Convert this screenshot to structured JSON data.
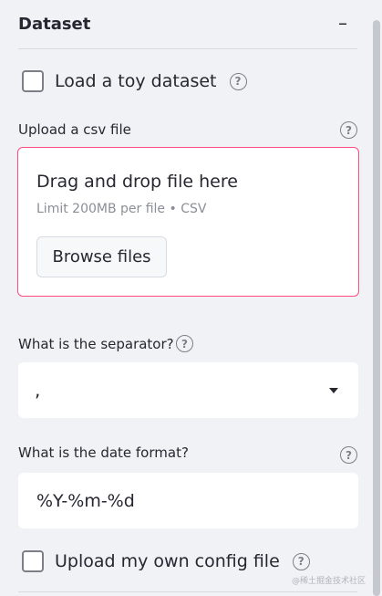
{
  "section": {
    "title": "Dataset",
    "collapse_symbol": "–"
  },
  "toy_dataset": {
    "label": "Load a toy dataset",
    "checked": false,
    "help_glyph": "?"
  },
  "upload": {
    "label": "Upload a csv file",
    "help_glyph": "?",
    "drop_text": "Drag and drop file here",
    "limit_text": "Limit 200MB per file • CSV",
    "browse_label": "Browse files",
    "accent_color": "#ff4b7f"
  },
  "separator": {
    "label": "What is the separator?",
    "help_glyph": "?",
    "selected_value": ","
  },
  "date_format": {
    "label": "What is the date format?",
    "help_glyph": "?",
    "value": "%Y-%m-%d"
  },
  "config_upload": {
    "label": "Upload my own config file",
    "checked": false,
    "help_glyph": "?"
  },
  "watermark": "@稀土掘金技术社区"
}
